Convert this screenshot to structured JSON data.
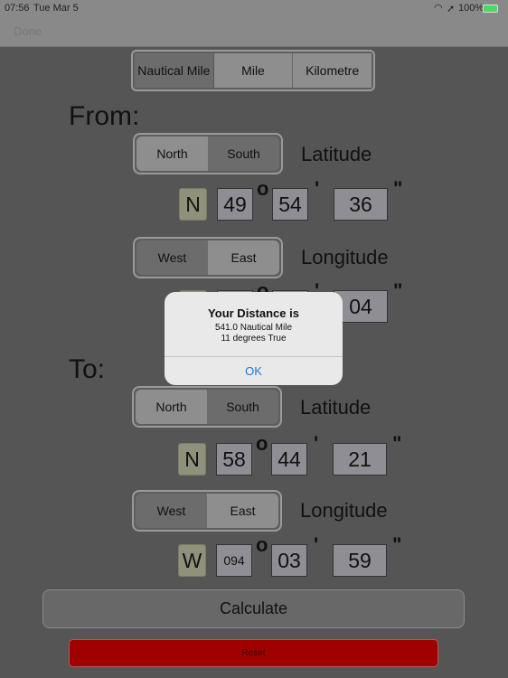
{
  "status": {
    "time": "07:56",
    "date": "Tue Mar 5",
    "battery": "100%"
  },
  "nav": {
    "done": "Done"
  },
  "units": {
    "options": [
      "Nautical Mile",
      "Mile",
      "Kilometre"
    ],
    "selected": "Nautical Mile"
  },
  "from": {
    "title": "From:",
    "lat": {
      "options": [
        "North",
        "South"
      ],
      "label": "Latitude",
      "hemi": "N",
      "deg": "49",
      "min": "54",
      "sec": "36"
    },
    "lon": {
      "options": [
        "West",
        "East"
      ],
      "label": "Longitude",
      "sec": "04"
    }
  },
  "to": {
    "title": "To:",
    "lat": {
      "options": [
        "North",
        "South"
      ],
      "label": "Latitude",
      "hemi": "N",
      "deg": "58",
      "min": "44",
      "sec": "21"
    },
    "lon": {
      "options": [
        "West",
        "East"
      ],
      "label": "Longitude",
      "hemi": "W",
      "deg": "094",
      "min": "03",
      "sec": "59"
    }
  },
  "symbols": {
    "deg": "o",
    "min": "'",
    "sec": "\""
  },
  "calculate": "Calculate",
  "reset": "Reset",
  "alert": {
    "title": "Your Distance is",
    "line1": "541.0 Nautical Mile",
    "line2": "11 degrees True",
    "ok": "OK"
  },
  "colors": {
    "reset": "#a00000",
    "ok": "#1a7be0",
    "battery": "#4cd964"
  }
}
